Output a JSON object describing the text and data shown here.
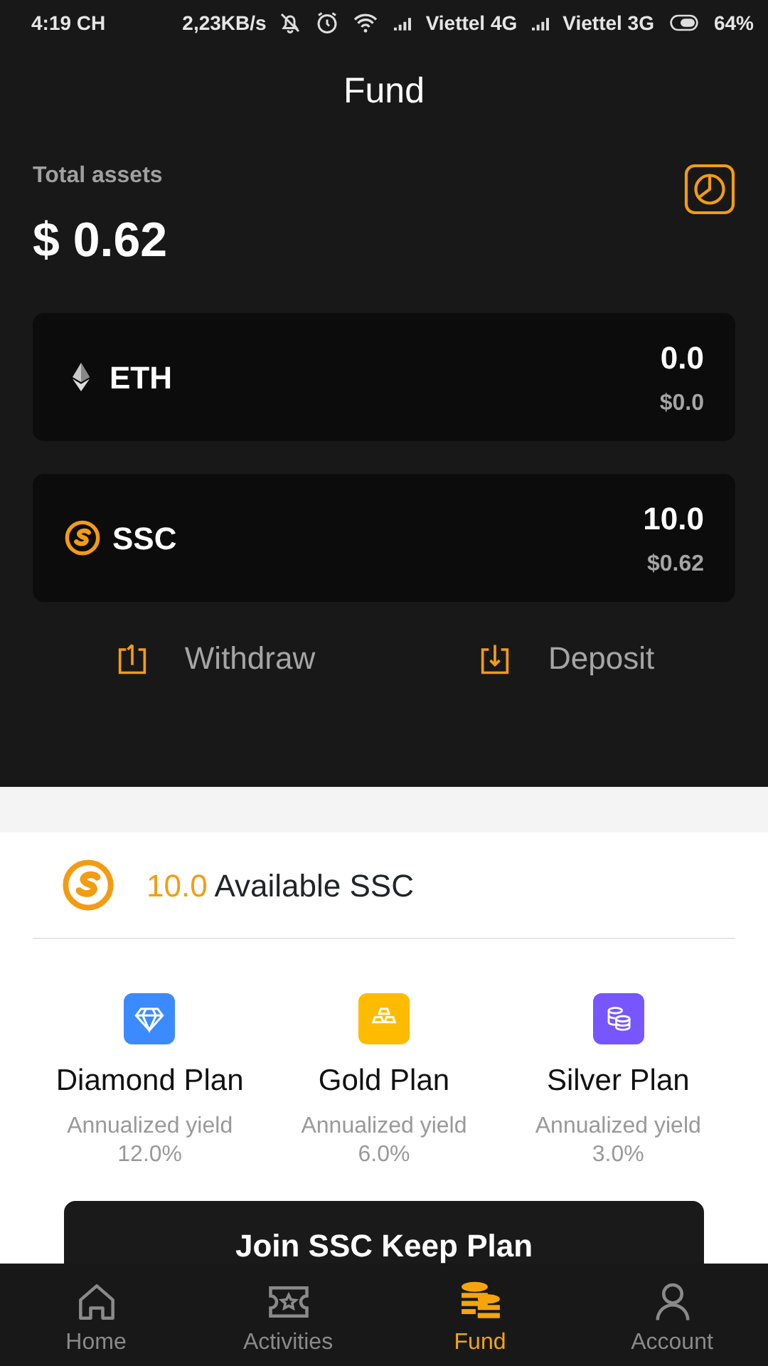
{
  "status_bar": {
    "time": "4:19 CH",
    "speed": "2,23KB/s",
    "carriers": [
      "Viettel 4G",
      "Viettel 3G"
    ],
    "battery": "64%"
  },
  "header": {
    "title": "Fund"
  },
  "assets": {
    "label": "Total assets",
    "total": "$ 0.62"
  },
  "coins": [
    {
      "kind": "eth",
      "symbol": "ETH",
      "amount": "0.0",
      "value": "$0.0"
    },
    {
      "kind": "ssc",
      "symbol": "SSC",
      "amount": "10.0",
      "value": "$0.62"
    }
  ],
  "actions": [
    {
      "kind": "withdraw",
      "label": "Withdraw"
    },
    {
      "kind": "deposit",
      "label": "Deposit"
    }
  ],
  "available": {
    "amount": "10.0",
    "label": "Available SSC"
  },
  "plans": [
    {
      "kind": "diamond",
      "name": "Diamond Plan",
      "yield_label": "Annualized yield",
      "yield": "12.0%",
      "color": "#3b8bff"
    },
    {
      "kind": "gold",
      "name": "Gold Plan",
      "yield_label": "Annualized yield",
      "yield": "6.0%",
      "color": "#ffbb00"
    },
    {
      "kind": "silver",
      "name": "Silver Plan",
      "yield_label": "Annualized yield",
      "yield": "3.0%",
      "color": "#7755ff"
    }
  ],
  "join_button": "Join SSC Keep Plan",
  "nav": [
    {
      "kind": "home",
      "label": "Home",
      "selected": false
    },
    {
      "kind": "activities",
      "label": "Activities",
      "selected": false
    },
    {
      "kind": "fund",
      "label": "Fund",
      "selected": true
    },
    {
      "kind": "account",
      "label": "Account",
      "selected": false
    }
  ]
}
